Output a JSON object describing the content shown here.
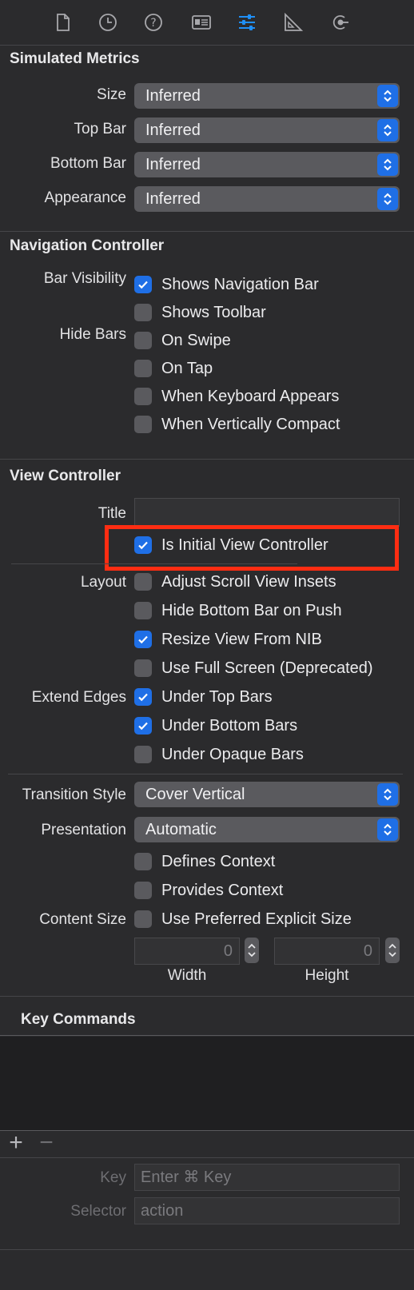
{
  "toolbar": {
    "icons": [
      "file-icon",
      "history-icon",
      "help-icon",
      "identity-icon",
      "attributes-icon",
      "size-ruler-icon",
      "connections-icon"
    ],
    "active_icon": "attributes-icon",
    "active_color": "#1f8ff6"
  },
  "simulated_metrics": {
    "title": "Simulated Metrics",
    "rows": [
      {
        "label": "Size",
        "value": "Inferred"
      },
      {
        "label": "Top Bar",
        "value": "Inferred"
      },
      {
        "label": "Bottom Bar",
        "value": "Inferred"
      },
      {
        "label": "Appearance",
        "value": "Inferred"
      }
    ]
  },
  "navigation_controller": {
    "title": "Navigation Controller",
    "bar_visibility_label": "Bar Visibility",
    "hide_bars_label": "Hide Bars",
    "checks": [
      {
        "label": "Shows Navigation Bar",
        "checked": true
      },
      {
        "label": "Shows Toolbar",
        "checked": false
      },
      {
        "label": "On Swipe",
        "checked": false
      },
      {
        "label": "On Tap",
        "checked": false
      },
      {
        "label": "When Keyboard Appears",
        "checked": false
      },
      {
        "label": "When Vertically Compact",
        "checked": false
      }
    ]
  },
  "view_controller": {
    "title": "View Controller",
    "title_label": "Title",
    "title_value": "",
    "initial_label": "Is Initial View Controller",
    "initial_checked": true,
    "layout_label": "Layout",
    "layout_checks": [
      {
        "label": "Adjust Scroll View Insets",
        "checked": false
      },
      {
        "label": "Hide Bottom Bar on Push",
        "checked": false
      },
      {
        "label": "Resize View From NIB",
        "checked": true
      },
      {
        "label": "Use Full Screen (Deprecated)",
        "checked": false
      }
    ],
    "extend_edges_label": "Extend Edges",
    "edge_checks": [
      {
        "label": "Under Top Bars",
        "checked": true
      },
      {
        "label": "Under Bottom Bars",
        "checked": true
      },
      {
        "label": "Under Opaque Bars",
        "checked": false
      }
    ],
    "transition_style_label": "Transition Style",
    "transition_style_value": "Cover Vertical",
    "presentation_label": "Presentation",
    "presentation_value": "Automatic",
    "context_checks": [
      {
        "label": "Defines Context",
        "checked": false
      },
      {
        "label": "Provides Context",
        "checked": false
      }
    ],
    "content_size_label": "Content Size",
    "content_size_check": {
      "label": "Use Preferred Explicit Size",
      "checked": false
    },
    "width_value": "0",
    "height_value": "0",
    "width_label": "Width",
    "height_label": "Height"
  },
  "key_commands": {
    "title": "Key Commands",
    "add_label": "+",
    "remove_label": "−",
    "key_label": "Key",
    "key_placeholder": "Enter ⌘ Key",
    "selector_label": "Selector",
    "selector_placeholder": "action"
  },
  "colors": {
    "accent": "#1f6fe6",
    "highlight": "#ff2d12"
  }
}
